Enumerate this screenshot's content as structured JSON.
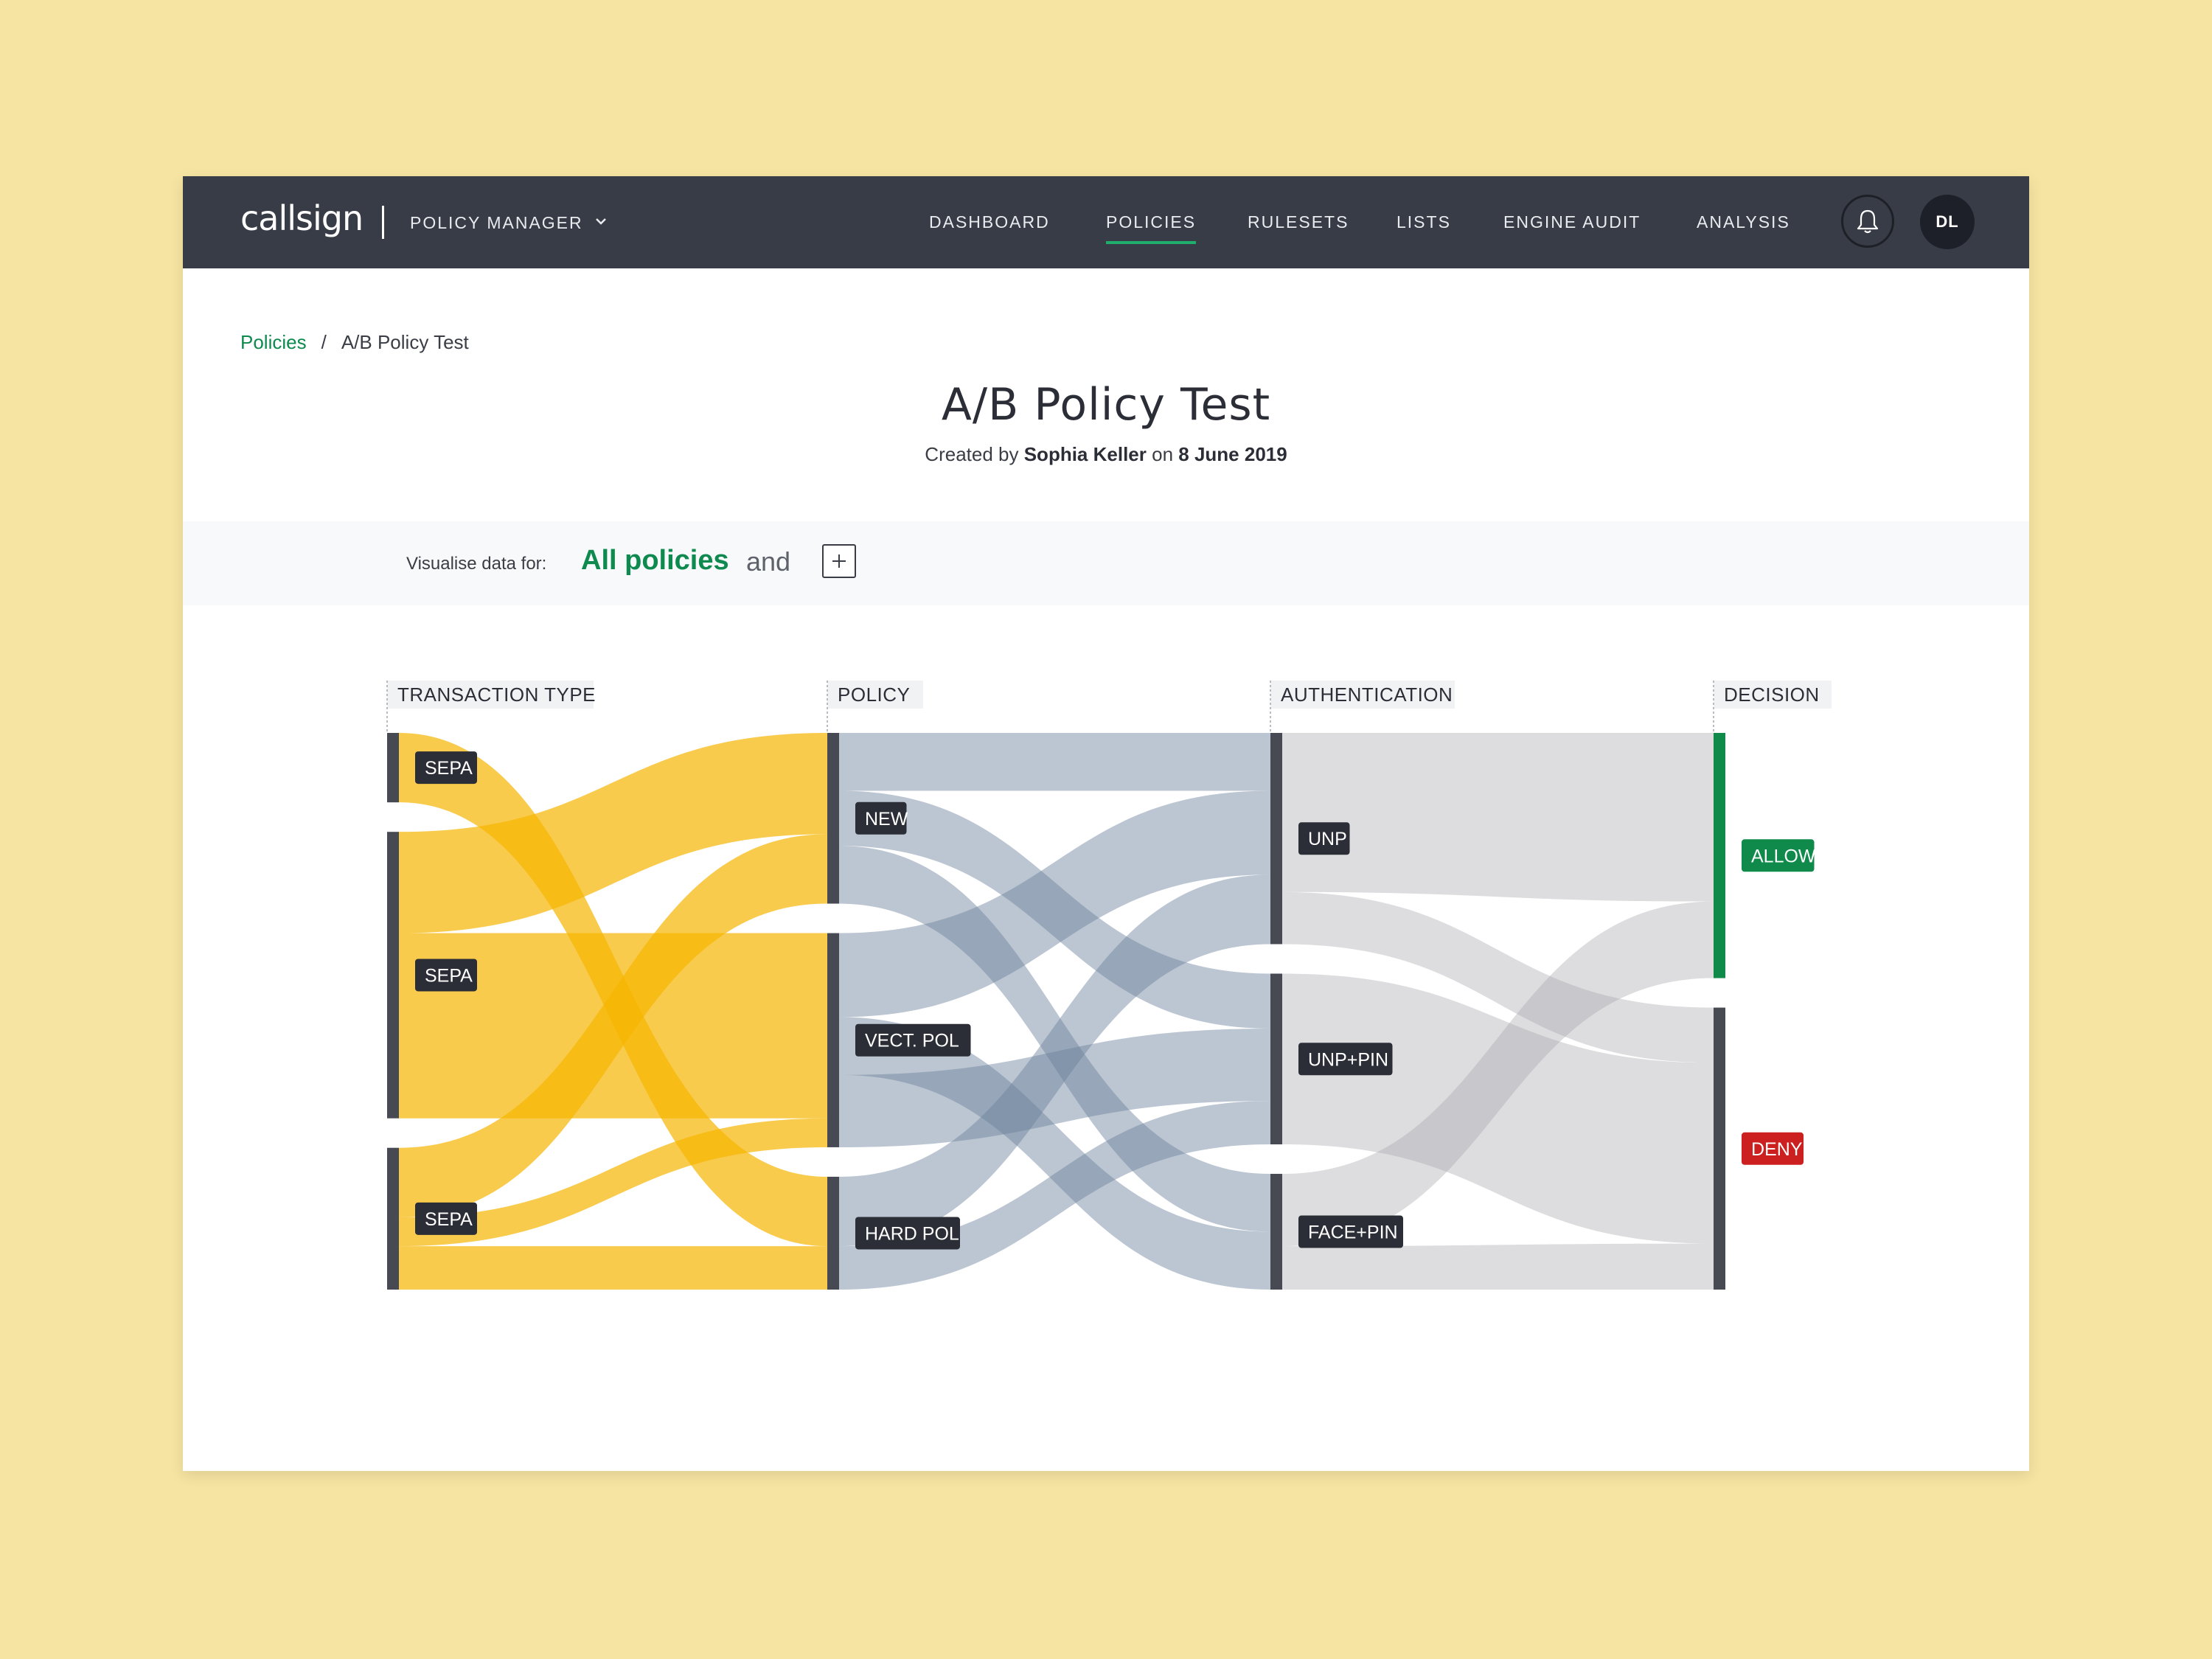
{
  "app": {
    "logo": "callsign",
    "app_switcher": "POLICY MANAGER",
    "user_initials": "DL"
  },
  "nav": [
    {
      "label": "DASHBOARD",
      "active": false
    },
    {
      "label": "POLICIES",
      "active": true
    },
    {
      "label": "RULESETS",
      "active": false
    },
    {
      "label": "LISTS",
      "active": false
    },
    {
      "label": "ENGINE AUDIT",
      "active": false
    },
    {
      "label": "ANALYSIS",
      "active": false
    }
  ],
  "breadcrumb": {
    "parent": "Policies",
    "separator": "/",
    "current": "A/B Policy Test"
  },
  "page": {
    "title": "A/B Policy Test",
    "created_prefix": "Created by",
    "author": "Sophia Keller",
    "created_mid": "on",
    "date": "8 June 2019"
  },
  "filter": {
    "label": "Visualise data for:",
    "value": "All policies",
    "conjunction": "and"
  },
  "chart_data": {
    "type": "sankey",
    "columns": [
      "TRANSACTION TYPE",
      "POLICY",
      "AUTHENTICATION",
      "DECISION"
    ],
    "nodes": [
      {
        "id": "t1",
        "label": "SEPA",
        "column": 0
      },
      {
        "id": "t2",
        "label": "SEPA",
        "column": 0
      },
      {
        "id": "t3",
        "label": "SEPA",
        "column": 0
      },
      {
        "id": "p1",
        "label": "NEW",
        "column": 1
      },
      {
        "id": "p2",
        "label": "VECT. POL",
        "column": 1
      },
      {
        "id": "p3",
        "label": "HARD POL",
        "column": 1
      },
      {
        "id": "a1",
        "label": "UNP",
        "column": 2
      },
      {
        "id": "a2",
        "label": "UNP+PIN",
        "column": 2
      },
      {
        "id": "a3",
        "label": "FACE+PIN",
        "column": 2
      },
      {
        "id": "d1",
        "label": "ALLOW",
        "column": 3
      },
      {
        "id": "d2",
        "label": "DENY",
        "column": 3
      }
    ],
    "links": [
      {
        "source": "t1",
        "target": "p3",
        "value": 48
      },
      {
        "source": "t2",
        "target": "p1",
        "value": 70
      },
      {
        "source": "t2",
        "target": "p2",
        "value": 128
      },
      {
        "source": "t3",
        "target": "p1",
        "value": 48
      },
      {
        "source": "t3",
        "target": "p2",
        "value": 20
      },
      {
        "source": "t3",
        "target": "p3",
        "value": 30
      },
      {
        "source": "p1",
        "target": "a1",
        "value": 40
      },
      {
        "source": "p1",
        "target": "a2",
        "value": 38
      },
      {
        "source": "p1",
        "target": "a3",
        "value": 40
      },
      {
        "source": "p2",
        "target": "a1",
        "value": 58
      },
      {
        "source": "p2",
        "target": "a3",
        "value": 40
      },
      {
        "source": "p2",
        "target": "a2",
        "value": 50
      },
      {
        "source": "p3",
        "target": "a1",
        "value": 48
      },
      {
        "source": "p3",
        "target": "a2",
        "value": 30
      },
      {
        "source": "a1",
        "target": "d1",
        "value": 110
      },
      {
        "source": "a1",
        "target": "d2",
        "value": 36
      },
      {
        "source": "a2",
        "target": "d2",
        "value": 118
      },
      {
        "source": "a3",
        "target": "d1",
        "value": 50
      },
      {
        "source": "a3",
        "target": "d2",
        "value": 30
      }
    ],
    "colors": {
      "col0_links": "#f7b500",
      "col1_links": "#6b819c",
      "col2_links": "#a9abb0",
      "node_bar": "#474a53",
      "allow": "#0f8a4a",
      "deny": "#cc1f1f"
    }
  }
}
